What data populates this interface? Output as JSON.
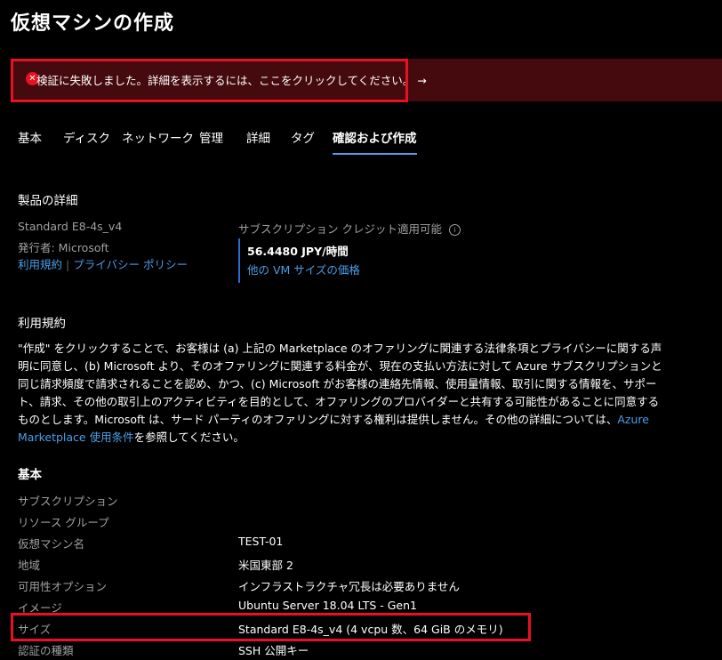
{
  "page_title": "仮想マシンの作成",
  "banner": {
    "message": "検証に失敗しました。詳細を表示するには、ここをクリックしてください。 →",
    "icon": "error-icon",
    "color": "#450a0e"
  },
  "tabs": [
    {
      "label": "基本"
    },
    {
      "label": "ディスク"
    },
    {
      "label": "ネットワーク"
    },
    {
      "label": "管理"
    },
    {
      "label": "詳細"
    },
    {
      "label": "タグ"
    },
    {
      "label": "確認および作成",
      "active": true
    }
  ],
  "product": {
    "heading": "製品の詳細",
    "name": "Standard E8-4s_v4",
    "publisher": "発行者: Microsoft",
    "terms_link": "利用規約",
    "privacy_link": "プライバシー ポリシー",
    "subscription_note": "サブスクリプション クレジット適用可能",
    "price": "56.4480 JPY/時間",
    "other_prices_link": "他の VM サイズの価格"
  },
  "terms": {
    "heading": "利用規約",
    "body_before_link": "\"作成\" をクリックすることで、お客様は (a) 上記の Marketplace のオファリングに関連する法律条項とプライバシーに関する声明に同意し、(b) Microsoft より、そのオファリングに関連する料金が、現在の支払い方法に対して Azure サブスクリプションと同じ請求頻度で請求されることを認め、かつ、(c) Microsoft がお客様の連絡先情報、使用量情報、取引に関する情報を、サポート、請求、その他の取引上のアクティビティを目的として、オファリングのプロバイダーと共有する可能性があることに同意するものとします。Microsoft は、サード パーティのオファリングに対する権利は提供しません。その他の詳細については、",
    "link": "Azure Marketplace 使用条件",
    "body_after_link": "を参照してください。"
  },
  "basics": {
    "heading": "基本",
    "rows": [
      {
        "label": "サブスクリプション",
        "value": ""
      },
      {
        "label": "リソース グループ",
        "value": ""
      },
      {
        "label": "仮想マシン名",
        "value": "TEST-01"
      },
      {
        "label": "地域",
        "value": "米国東部 2"
      },
      {
        "label": "可用性オプション",
        "value": "インフラストラクチャ冗長は必要ありません"
      },
      {
        "label": "イメージ",
        "value": "Ubuntu Server 18.04 LTS - Gen1"
      },
      {
        "label": "サイズ",
        "value": "Standard E8-4s_v4 (4 vcpu 数、64 GiB のメモリ)"
      },
      {
        "label": "認証の種類",
        "value": "SSH 公開キー"
      }
    ]
  },
  "colors": {
    "accent": "#4a9fe8",
    "highlight_box": "#e81123"
  }
}
